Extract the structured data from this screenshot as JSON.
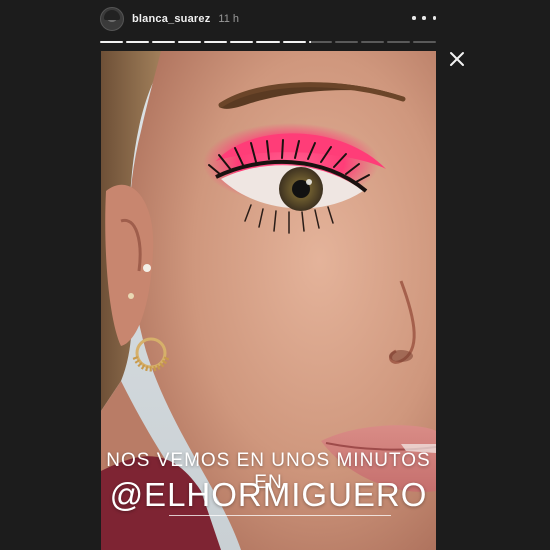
{
  "story": {
    "username": "blanca_suarez",
    "time_ago": "11 h",
    "progress": {
      "total_segments": 13,
      "completed_segments": 8,
      "current_fraction": 0.1
    },
    "caption": {
      "line1": "NOS VEMOS EN UNOS MINUTOS EN",
      "mention": "@ELHORMIGUERO"
    }
  },
  "icons": {
    "more": "more-horizontal-icon",
    "close": "close-icon"
  },
  "colors": {
    "background": "#1c1c1c",
    "eyeshadow": "#ff3d78",
    "text": "#ffffff"
  }
}
